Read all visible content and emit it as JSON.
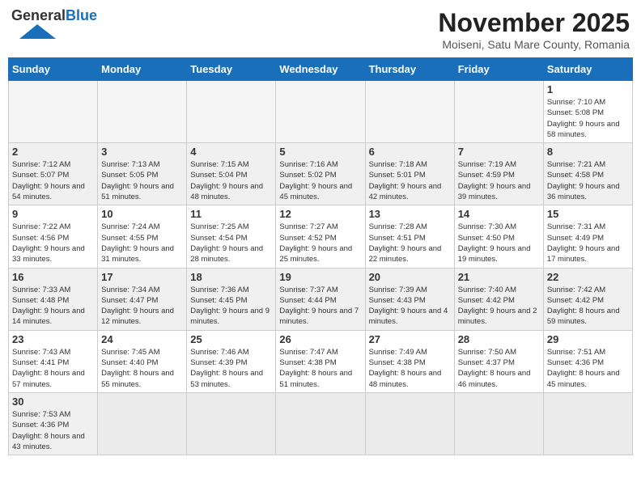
{
  "header": {
    "logo_main": "General",
    "logo_accent": "Blue",
    "month_year": "November 2025",
    "location": "Moiseni, Satu Mare County, Romania"
  },
  "weekdays": [
    "Sunday",
    "Monday",
    "Tuesday",
    "Wednesday",
    "Thursday",
    "Friday",
    "Saturday"
  ],
  "weeks": [
    [
      {
        "day": "",
        "info": ""
      },
      {
        "day": "",
        "info": ""
      },
      {
        "day": "",
        "info": ""
      },
      {
        "day": "",
        "info": ""
      },
      {
        "day": "",
        "info": ""
      },
      {
        "day": "",
        "info": ""
      },
      {
        "day": "1",
        "info": "Sunrise: 7:10 AM\nSunset: 5:08 PM\nDaylight: 9 hours\nand 58 minutes."
      }
    ],
    [
      {
        "day": "2",
        "info": "Sunrise: 7:12 AM\nSunset: 5:07 PM\nDaylight: 9 hours\nand 54 minutes."
      },
      {
        "day": "3",
        "info": "Sunrise: 7:13 AM\nSunset: 5:05 PM\nDaylight: 9 hours\nand 51 minutes."
      },
      {
        "day": "4",
        "info": "Sunrise: 7:15 AM\nSunset: 5:04 PM\nDaylight: 9 hours\nand 48 minutes."
      },
      {
        "day": "5",
        "info": "Sunrise: 7:16 AM\nSunset: 5:02 PM\nDaylight: 9 hours\nand 45 minutes."
      },
      {
        "day": "6",
        "info": "Sunrise: 7:18 AM\nSunset: 5:01 PM\nDaylight: 9 hours\nand 42 minutes."
      },
      {
        "day": "7",
        "info": "Sunrise: 7:19 AM\nSunset: 4:59 PM\nDaylight: 9 hours\nand 39 minutes."
      },
      {
        "day": "8",
        "info": "Sunrise: 7:21 AM\nSunset: 4:58 PM\nDaylight: 9 hours\nand 36 minutes."
      }
    ],
    [
      {
        "day": "9",
        "info": "Sunrise: 7:22 AM\nSunset: 4:56 PM\nDaylight: 9 hours\nand 33 minutes."
      },
      {
        "day": "10",
        "info": "Sunrise: 7:24 AM\nSunset: 4:55 PM\nDaylight: 9 hours\nand 31 minutes."
      },
      {
        "day": "11",
        "info": "Sunrise: 7:25 AM\nSunset: 4:54 PM\nDaylight: 9 hours\nand 28 minutes."
      },
      {
        "day": "12",
        "info": "Sunrise: 7:27 AM\nSunset: 4:52 PM\nDaylight: 9 hours\nand 25 minutes."
      },
      {
        "day": "13",
        "info": "Sunrise: 7:28 AM\nSunset: 4:51 PM\nDaylight: 9 hours\nand 22 minutes."
      },
      {
        "day": "14",
        "info": "Sunrise: 7:30 AM\nSunset: 4:50 PM\nDaylight: 9 hours\nand 19 minutes."
      },
      {
        "day": "15",
        "info": "Sunrise: 7:31 AM\nSunset: 4:49 PM\nDaylight: 9 hours\nand 17 minutes."
      }
    ],
    [
      {
        "day": "16",
        "info": "Sunrise: 7:33 AM\nSunset: 4:48 PM\nDaylight: 9 hours\nand 14 minutes."
      },
      {
        "day": "17",
        "info": "Sunrise: 7:34 AM\nSunset: 4:47 PM\nDaylight: 9 hours\nand 12 minutes."
      },
      {
        "day": "18",
        "info": "Sunrise: 7:36 AM\nSunset: 4:45 PM\nDaylight: 9 hours\nand 9 minutes."
      },
      {
        "day": "19",
        "info": "Sunrise: 7:37 AM\nSunset: 4:44 PM\nDaylight: 9 hours\nand 7 minutes."
      },
      {
        "day": "20",
        "info": "Sunrise: 7:39 AM\nSunset: 4:43 PM\nDaylight: 9 hours\nand 4 minutes."
      },
      {
        "day": "21",
        "info": "Sunrise: 7:40 AM\nSunset: 4:42 PM\nDaylight: 9 hours\nand 2 minutes."
      },
      {
        "day": "22",
        "info": "Sunrise: 7:42 AM\nSunset: 4:42 PM\nDaylight: 8 hours\nand 59 minutes."
      }
    ],
    [
      {
        "day": "23",
        "info": "Sunrise: 7:43 AM\nSunset: 4:41 PM\nDaylight: 8 hours\nand 57 minutes."
      },
      {
        "day": "24",
        "info": "Sunrise: 7:45 AM\nSunset: 4:40 PM\nDaylight: 8 hours\nand 55 minutes."
      },
      {
        "day": "25",
        "info": "Sunrise: 7:46 AM\nSunset: 4:39 PM\nDaylight: 8 hours\nand 53 minutes."
      },
      {
        "day": "26",
        "info": "Sunrise: 7:47 AM\nSunset: 4:38 PM\nDaylight: 8 hours\nand 51 minutes."
      },
      {
        "day": "27",
        "info": "Sunrise: 7:49 AM\nSunset: 4:38 PM\nDaylight: 8 hours\nand 48 minutes."
      },
      {
        "day": "28",
        "info": "Sunrise: 7:50 AM\nSunset: 4:37 PM\nDaylight: 8 hours\nand 46 minutes."
      },
      {
        "day": "29",
        "info": "Sunrise: 7:51 AM\nSunset: 4:36 PM\nDaylight: 8 hours\nand 45 minutes."
      }
    ],
    [
      {
        "day": "30",
        "info": "Sunrise: 7:53 AM\nSunset: 4:36 PM\nDaylight: 8 hours\nand 43 minutes."
      },
      {
        "day": "",
        "info": ""
      },
      {
        "day": "",
        "info": ""
      },
      {
        "day": "",
        "info": ""
      },
      {
        "day": "",
        "info": ""
      },
      {
        "day": "",
        "info": ""
      },
      {
        "day": "",
        "info": ""
      }
    ]
  ]
}
